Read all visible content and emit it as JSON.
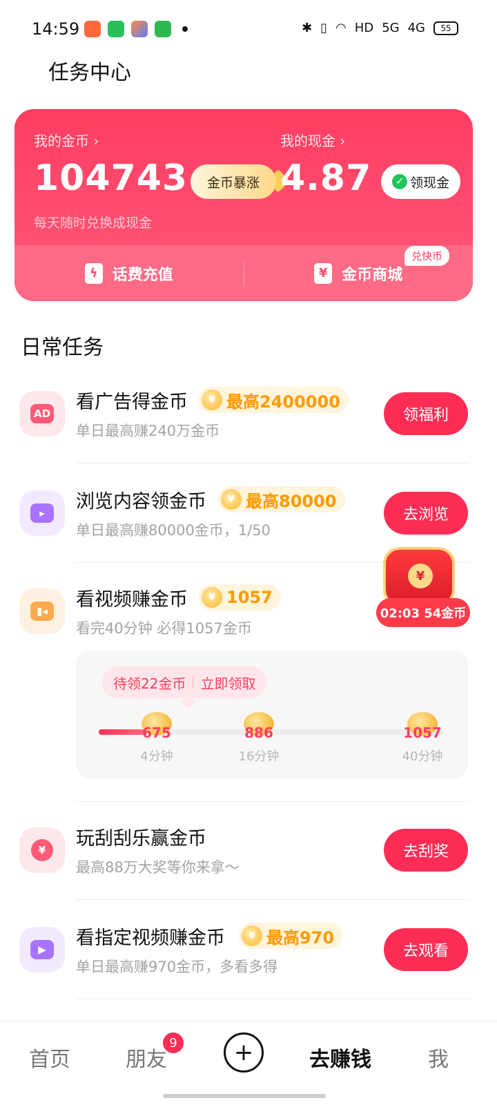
{
  "status_bar": {
    "time": "14:59",
    "network": "HD",
    "sig1": "5G",
    "sig2": "4G",
    "battery": "55"
  },
  "header": {
    "title": "任务中心"
  },
  "wallet": {
    "coins_label": "我的金币 ›",
    "coins_value": "104743",
    "coins_pill": "金币暴涨",
    "cash_label": "我的现金 ›",
    "cash_value": "4.87",
    "cash_pill": "领现金",
    "subtitle": "每天随时兑换成现金",
    "action_phone": "话费充值",
    "action_mall": "金币商城",
    "mall_badge": "兑快币"
  },
  "section": {
    "title": "日常任务"
  },
  "tasks": [
    {
      "title": "看广告得金币",
      "reward": "最高2400000",
      "sub": "单日最高赚240万金币",
      "button": "领福利",
      "icon_text": "AD"
    },
    {
      "title": "浏览内容领金币",
      "reward": "最高80000",
      "sub": "单日最高赚80000金币，1/50",
      "button": "去浏览"
    },
    {
      "title": "看视频赚金币",
      "reward": "1057",
      "sub": "看完40分钟 必得1057金币"
    },
    {
      "title": "玩刮刮乐赢金币",
      "sub": "最高88万大奖等你来拿～",
      "button": "去刮奖"
    },
    {
      "title": "看指定视频赚金币",
      "reward": "最高970",
      "sub": "单日最高赚970金币，多看多得",
      "button": "去观看"
    }
  ],
  "video_progress": {
    "pending_text": "待领22金币",
    "claim_text": "立即领取",
    "fill_fraction": 0.14,
    "milestones": [
      {
        "value": "675",
        "time": "4分钟"
      },
      {
        "value": "886",
        "time": "16分钟"
      },
      {
        "value": "1057",
        "time": "40分钟"
      }
    ]
  },
  "chest": {
    "timer": "02:03 54金币"
  },
  "bottom_nav": {
    "home": "首页",
    "friends": "朋友",
    "friends_badge": "9",
    "earn": "去赚钱",
    "me": "我"
  },
  "colors": {
    "accent": "#ff2d55",
    "gold": "#ff9a00"
  }
}
